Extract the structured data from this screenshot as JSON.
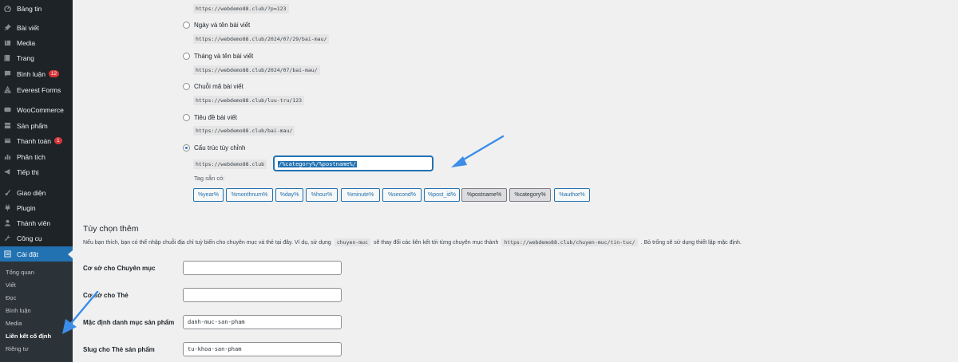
{
  "sidebar": {
    "items": [
      {
        "label": "Bảng tin",
        "icon": "dashboard-icon"
      },
      {
        "label": "Bài viết",
        "icon": "pin-icon"
      },
      {
        "label": "Media",
        "icon": "media-icon"
      },
      {
        "label": "Trang",
        "icon": "page-icon"
      },
      {
        "label": "Bình luận",
        "icon": "comment-icon",
        "badge": "12"
      },
      {
        "label": "Everest Forms",
        "icon": "forms-icon"
      },
      {
        "label": "WooCommerce",
        "icon": "woocommerce-icon"
      },
      {
        "label": "Sản phẩm",
        "icon": "product-icon"
      },
      {
        "label": "Thanh toán",
        "icon": "payment-icon",
        "badge": "1"
      },
      {
        "label": "Phân tích",
        "icon": "analytics-icon"
      },
      {
        "label": "Tiếp thị",
        "icon": "marketing-icon"
      },
      {
        "label": "Giao diện",
        "icon": "appearance-icon"
      },
      {
        "label": "Plugin",
        "icon": "plugin-icon"
      },
      {
        "label": "Thành viên",
        "icon": "users-icon"
      },
      {
        "label": "Công cụ",
        "icon": "tools-icon"
      },
      {
        "label": "Cài đặt",
        "icon": "settings-icon",
        "active": true
      }
    ],
    "submenu": [
      "Tổng quan",
      "Viết",
      "Đọc",
      "Bình luận",
      "Media",
      "Liên kết cố định",
      "Riêng tư"
    ],
    "submenu_current": "Liên kết cố định"
  },
  "permalinks": {
    "top_code": "https://webdemo88.club/?p=123",
    "options": [
      {
        "label": "Ngày và tên bài viết",
        "example": "https://webdemo88.club/2024/07/29/bai-mau/"
      },
      {
        "label": "Tháng và tên bài viết",
        "example": "https://webdemo88.club/2024/07/bai-mau/"
      },
      {
        "label": "Chuỗi mã bài viết",
        "example": "https://webdemo88.club/luu-tru/123"
      },
      {
        "label": "Tiêu đề bài viết",
        "example": "https://webdemo88.club/bai-mau/"
      }
    ],
    "custom": {
      "label": "Cấu trúc tùy chỉnh",
      "base": "https://webdemo88.club",
      "value": "/%category%/%postname%/",
      "tags_label": "Tag sẵn có:",
      "tags": [
        {
          "label": "%year%",
          "active": false
        },
        {
          "label": "%monthnum%",
          "active": false
        },
        {
          "label": "%day%",
          "active": false
        },
        {
          "label": "%hour%",
          "active": false
        },
        {
          "label": "%minute%",
          "active": false
        },
        {
          "label": "%second%",
          "active": false
        },
        {
          "label": "%post_id%",
          "active": false
        },
        {
          "label": "%postname%",
          "active": true
        },
        {
          "label": "%category%",
          "active": true
        },
        {
          "label": "%author%",
          "active": false
        }
      ]
    }
  },
  "optional": {
    "title": "Tùy chọn thêm",
    "desc_before": "Nếu bạn thích, bạn có thể nhập chuỗi địa chỉ tuỳ biến cho chuyên mục và thẻ tại đây. Ví dụ, sử dụng",
    "desc_code1": "chuyen-muc",
    "desc_middle": "sẽ thay đổi các liên kết tới từng chuyên mục thành",
    "desc_code2": "https://webdemo88.club/chuyen-muc/tin-tuc/",
    "desc_after": ". Bỏ trống sẽ sử dụng thiết lập mặc định.",
    "fields": [
      {
        "label": "Cơ sở cho Chuyên mục",
        "value": ""
      },
      {
        "label": "Cơ sở cho Thẻ",
        "value": ""
      },
      {
        "label": "Mặc định danh mục sản phẩm",
        "value": "danh-muc-san-pham"
      },
      {
        "label": "Slug cho Thẻ sản phẩm",
        "value": "tu-khoa-san-pham"
      }
    ]
  },
  "colors": {
    "accent": "#2271b1",
    "arrow": "#3b8de8",
    "sidebar": "#1d2327"
  }
}
